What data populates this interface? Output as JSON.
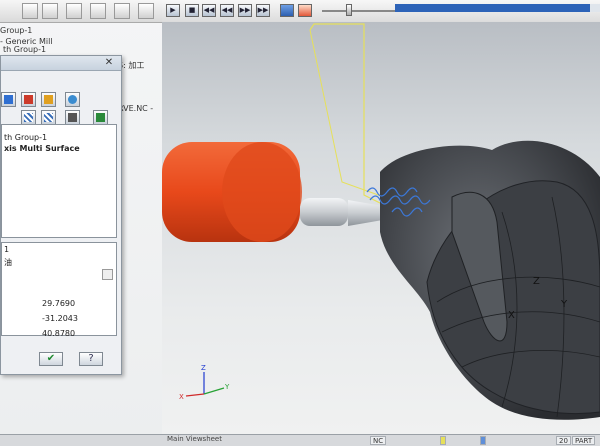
{
  "tree": {
    "lines": [
      "Group-1",
      " - Generic Mill",
      "th Group-1",
      "S: 加工",
      "RVE.NC -"
    ]
  },
  "dialog": {
    "close_glyph": "✕",
    "op_list": [
      "th Group-1",
      "xis Multi Surface"
    ],
    "params_header": "1",
    "param_label": "油",
    "values": [
      "29.7690",
      "-31.2043",
      "40.8780"
    ],
    "ok_glyph": "✔",
    "help_glyph": "?"
  },
  "sim_toolbar": {
    "buttons": [
      "▶",
      "■",
      "◀◀",
      "◀◀",
      "▶▶",
      "▶▶"
    ],
    "progress": 0.95
  },
  "viewport": {
    "label": "Main Viewsheet",
    "axis": {
      "x": "X",
      "y": "Y",
      "z": "Z"
    },
    "part_axis": {
      "x": "X",
      "y": "Y",
      "z": "Z"
    }
  },
  "status": {
    "cells": [
      "NC",
      "20",
      "PART"
    ]
  },
  "colors": {
    "tool_holder": "#e8491b",
    "tool_shank": "#c8ccd0",
    "part": "#4a4d52",
    "toolpath": "#3c78d8",
    "stock_outline": "#e6e05a"
  }
}
